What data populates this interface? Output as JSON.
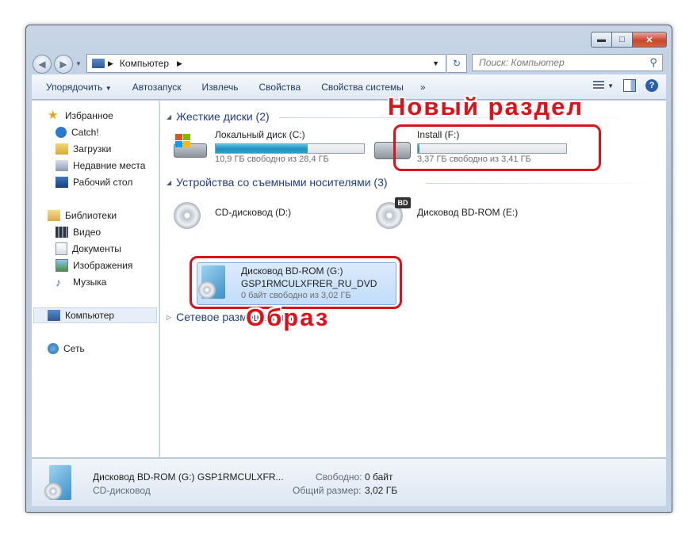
{
  "window": {
    "address_path": "Компьютер",
    "search_placeholder": "Поиск: Компьютер"
  },
  "toolbar": {
    "items": [
      "Упорядочить",
      "Автозапуск",
      "Извлечь",
      "Свойства",
      "Свойства системы"
    ],
    "more": "»"
  },
  "sidebar": {
    "favorites": {
      "label": "Избранное",
      "items": [
        "Catch!",
        "Загрузки",
        "Недавние места",
        "Рабочий стол"
      ]
    },
    "libraries": {
      "label": "Библиотеки",
      "items": [
        "Видео",
        "Документы",
        "Изображения",
        "Музыка"
      ]
    },
    "computer": "Компьютер",
    "network": "Сеть"
  },
  "content": {
    "hard_drives": {
      "header": "Жесткие диски (2)",
      "drives": [
        {
          "name": "Локальный диск (C:)",
          "space": "10,9 ГБ свободно из 28,4 ГБ",
          "used_fraction": 0.62
        },
        {
          "name": "Install (F:)",
          "space": "3,37 ГБ свободно из 3,41 ГБ",
          "used_fraction": 0.01
        }
      ]
    },
    "removable": {
      "header": "Устройства со съемными носителями (3)",
      "devices": [
        {
          "name": "CD-дисковод (D:)"
        },
        {
          "name": "Дисковод BD-ROM (E:)"
        },
        {
          "name": "Дисковод BD-ROM (G:)",
          "label": "GSP1RMCULXFRER_RU_DVD",
          "space": "0 байт свободно из 3,02 ГБ"
        }
      ]
    },
    "network": {
      "header": "Сетевое размещение (1)"
    },
    "annotations": {
      "new_partition": "Новый раздел",
      "image": "Образ"
    }
  },
  "details": {
    "title": "Дисковод BD-ROM (G:) GSP1RMCULXFR...",
    "type": "CD-дисковод",
    "free_label": "Свободно:",
    "free_value": "0 байт",
    "total_label": "Общий размер:",
    "total_value": "3,02 ГБ"
  },
  "colors": {
    "annotation_red": "#d9121c",
    "progress_blue": "#1f8fbf",
    "group_header": "#1e3c8c"
  }
}
